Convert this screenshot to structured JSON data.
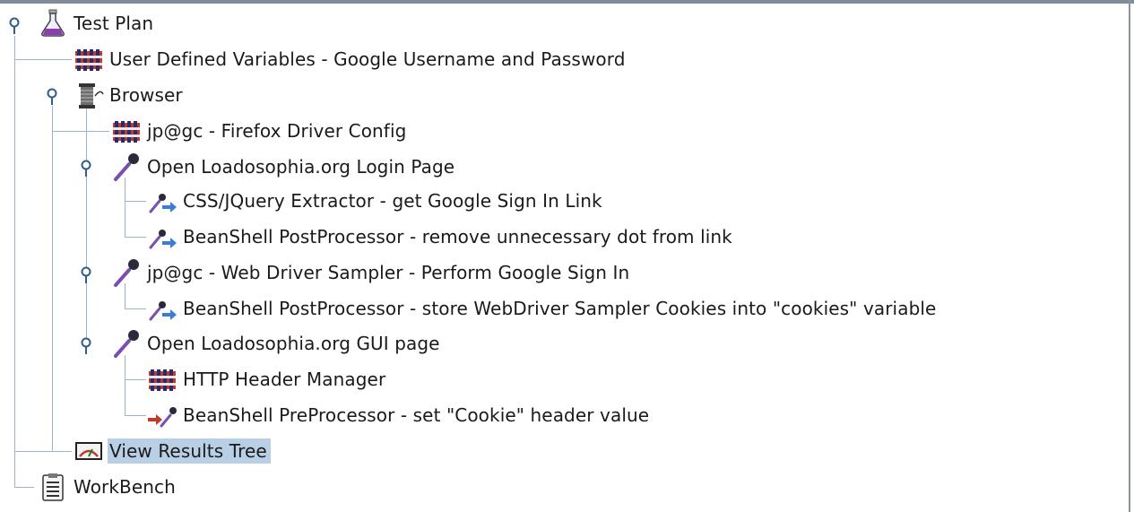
{
  "tree": {
    "nodes": [
      {
        "id": "test-plan",
        "label": "Test Plan",
        "icon": "test-plan-flask-icon"
      },
      {
        "id": "user-defined-variables",
        "label": "User Defined Variables - Google Username and Password",
        "icon": "config-element-icon"
      },
      {
        "id": "browser",
        "label": "Browser",
        "icon": "thread-group-spool-icon"
      },
      {
        "id": "firefox-driver-config",
        "label": "jp@gc - Firefox Driver Config",
        "icon": "config-element-icon"
      },
      {
        "id": "open-login-page",
        "label": "Open Loadosophia.org Login Page",
        "icon": "sampler-pipette-icon"
      },
      {
        "id": "css-jquery-extractor",
        "label": "CSS/JQuery Extractor - get Google Sign In Link",
        "icon": "post-processor-icon"
      },
      {
        "id": "beanshell-postprocessor-dot",
        "label": "BeanShell PostProcessor - remove unnecessary dot from link",
        "icon": "post-processor-icon"
      },
      {
        "id": "web-driver-sampler",
        "label": "jp@gc - Web Driver Sampler - Perform Google Sign In",
        "icon": "sampler-pipette-icon"
      },
      {
        "id": "beanshell-postprocessor-cookies",
        "label": "BeanShell PostProcessor - store WebDriver Sampler Cookies into \"cookies\" variable",
        "icon": "post-processor-icon"
      },
      {
        "id": "open-gui-page",
        "label": "Open Loadosophia.org GUI page",
        "icon": "sampler-pipette-icon"
      },
      {
        "id": "http-header-manager",
        "label": "HTTP Header Manager",
        "icon": "config-element-icon"
      },
      {
        "id": "beanshell-preprocessor",
        "label": "BeanShell PreProcessor - set \"Cookie\" header value",
        "icon": "pre-processor-icon"
      },
      {
        "id": "view-results-tree",
        "label": "View Results Tree",
        "icon": "listener-monitor-icon"
      },
      {
        "id": "workbench",
        "label": "WorkBench",
        "icon": "workbench-clipboard-icon"
      }
    ],
    "selected": "View Results Tree"
  }
}
